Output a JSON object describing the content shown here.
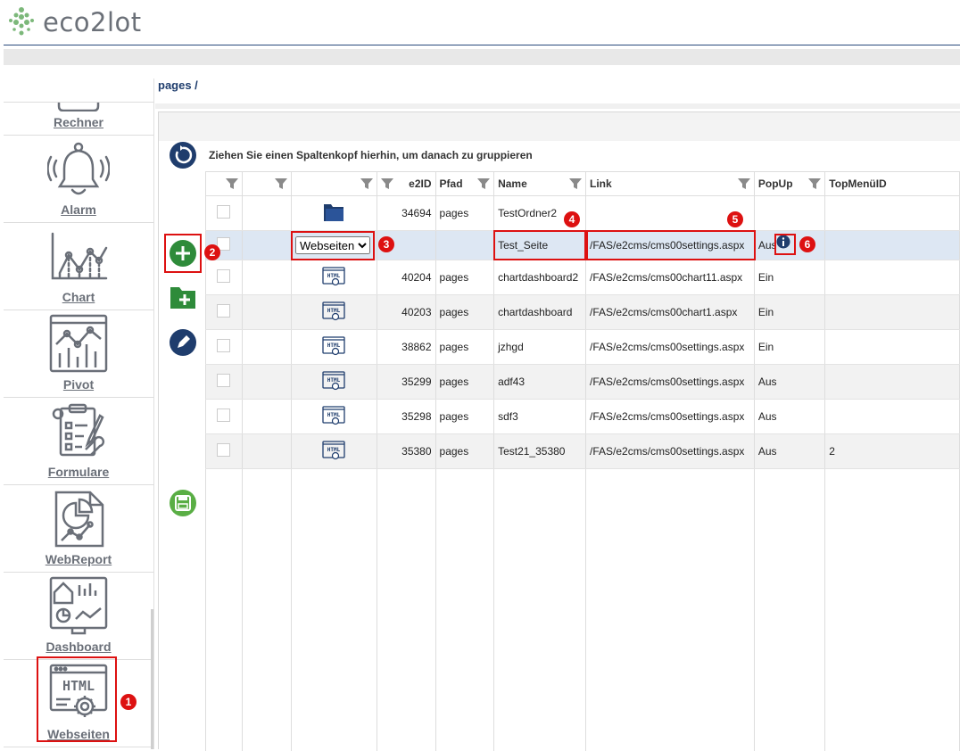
{
  "app": {
    "logo_text": "eco2lot"
  },
  "breadcrumb": "pages /",
  "sidebar": {
    "items": [
      {
        "label": "Rechner",
        "icon": "calculator-icon"
      },
      {
        "label": "Alarm",
        "icon": "bell-icon"
      },
      {
        "label": "Chart",
        "icon": "line-chart-icon"
      },
      {
        "label": "Pivot",
        "icon": "pivot-chart-icon"
      },
      {
        "label": "Formulare",
        "icon": "form-icon"
      },
      {
        "label": "WebReport",
        "icon": "report-icon"
      },
      {
        "label": "Dashboard",
        "icon": "dashboard-icon"
      },
      {
        "label": "Webseiten",
        "icon": "html-page-icon"
      }
    ]
  },
  "group_hint": "Ziehen Sie einen Spaltenkopf hierhin, um danach zu gruppieren",
  "columns": [
    "",
    "",
    "",
    "e2ID",
    "Pfad",
    "Name",
    "Link",
    "PopUp",
    "TopMenüID"
  ],
  "new_row": {
    "type_value": "Webseiten",
    "name": "Test_Seite",
    "link": "/FAS/e2cms/cms00settings.aspx",
    "popup": "Aus"
  },
  "rows": [
    {
      "type": "folder",
      "e2id": "34694",
      "pfad": "pages",
      "name": "TestOrdner2",
      "link": "",
      "popup": "",
      "topmenu": ""
    },
    {
      "type": "html",
      "e2id": "40204",
      "pfad": "pages",
      "name": "chartdashboard2",
      "link": "/FAS/e2cms/cms00chart11.aspx",
      "popup": "Ein",
      "topmenu": ""
    },
    {
      "type": "html",
      "e2id": "40203",
      "pfad": "pages",
      "name": "chartdashboard",
      "link": "/FAS/e2cms/cms00chart1.aspx",
      "popup": "Ein",
      "topmenu": ""
    },
    {
      "type": "html",
      "e2id": "38862",
      "pfad": "pages",
      "name": "jzhgd",
      "link": "/FAS/e2cms/cms00settings.aspx",
      "popup": "Ein",
      "topmenu": ""
    },
    {
      "type": "html",
      "e2id": "35299",
      "pfad": "pages",
      "name": "adf43",
      "link": "/FAS/e2cms/cms00settings.aspx",
      "popup": "Aus",
      "topmenu": ""
    },
    {
      "type": "html",
      "e2id": "35298",
      "pfad": "pages",
      "name": "sdf3",
      "link": "/FAS/e2cms/cms00settings.aspx",
      "popup": "Aus",
      "topmenu": ""
    },
    {
      "type": "html",
      "e2id": "35380",
      "pfad": "pages",
      "name": "Test21_35380",
      "link": "/FAS/e2cms/cms00settings.aspx",
      "popup": "Aus",
      "topmenu": "2"
    }
  ],
  "badges": [
    "1",
    "2",
    "3",
    "4",
    "5",
    "6"
  ],
  "colors": {
    "navy": "#1f3d6d",
    "green": "#2e8b3a",
    "red": "#d11111",
    "icon_gray": "#6a6f78",
    "selected_row": "#dde7f3"
  }
}
